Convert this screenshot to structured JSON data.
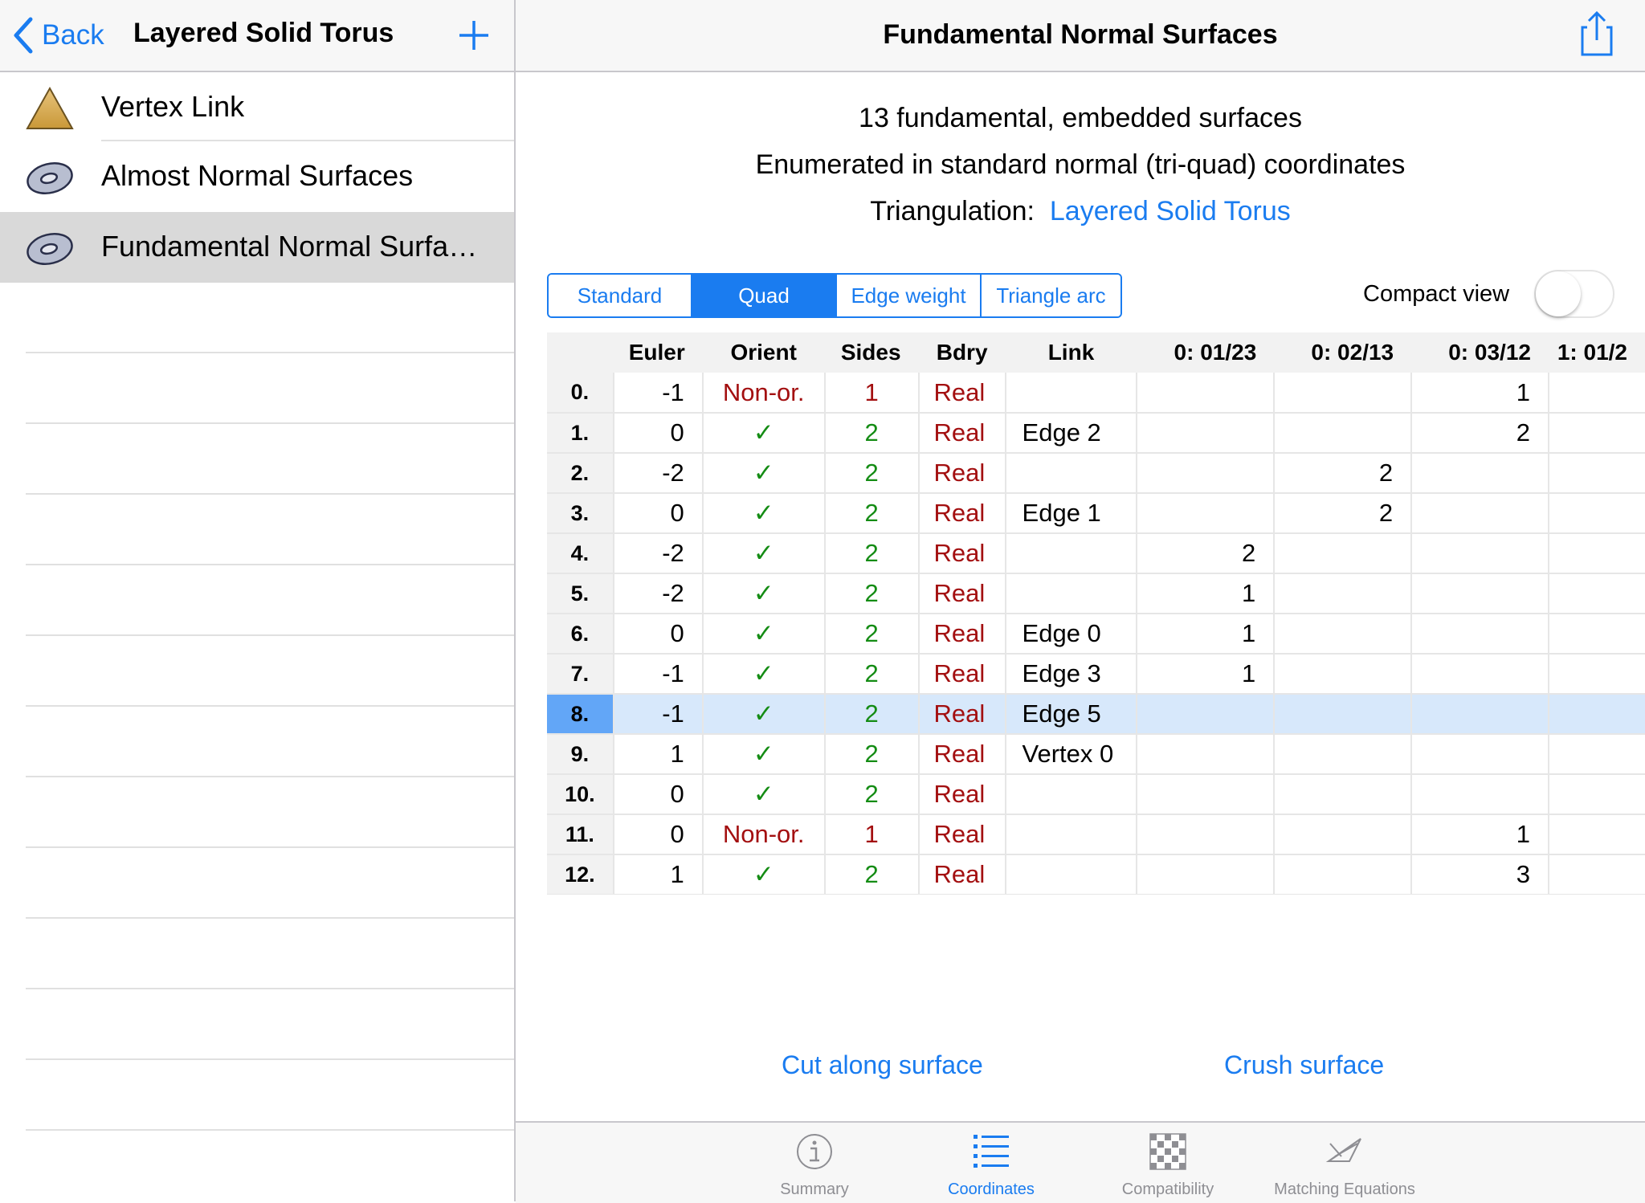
{
  "sidebar": {
    "back_label": "Back",
    "title": "Layered Solid Torus",
    "items": [
      {
        "label": "Vertex Link",
        "icon": "triangle-icon"
      },
      {
        "label": "Almost Normal Surfaces",
        "icon": "surface-icon"
      },
      {
        "label": "Fundamental Normal Surfa…",
        "icon": "surface-icon",
        "selected": true
      }
    ]
  },
  "main": {
    "title": "Fundamental Normal Surfaces",
    "summary_line1": "13 fundamental, embedded surfaces",
    "summary_line2": "Enumerated in standard normal (tri-quad) coordinates",
    "triangulation_label": "Triangulation:",
    "triangulation_link": "Layered Solid Torus",
    "segments": [
      "Standard",
      "Quad",
      "Edge weight",
      "Triangle arc"
    ],
    "active_segment": "Quad",
    "compact_view_label": "Compact view",
    "compact_view_on": false,
    "table": {
      "headers": [
        "",
        "Euler",
        "Orient",
        "Sides",
        "Bdry",
        "Link",
        "0: 01/23",
        "0: 02/13",
        "0: 03/12",
        "1: 01/2"
      ],
      "selected_row": 8,
      "rows": [
        [
          "0.",
          "-1",
          "Non-or.",
          "1",
          "Real",
          "",
          "",
          "",
          "1",
          ""
        ],
        [
          "1.",
          "0",
          "✓",
          "2",
          "Real",
          "Edge 2",
          "",
          "",
          "2",
          ""
        ],
        [
          "2.",
          "-2",
          "✓",
          "2",
          "Real",
          "",
          "",
          "2",
          "",
          ""
        ],
        [
          "3.",
          "0",
          "✓",
          "2",
          "Real",
          "Edge 1",
          "",
          "2",
          "",
          ""
        ],
        [
          "4.",
          "-2",
          "✓",
          "2",
          "Real",
          "",
          "2",
          "",
          "",
          ""
        ],
        [
          "5.",
          "-2",
          "✓",
          "2",
          "Real",
          "",
          "1",
          "",
          "",
          ""
        ],
        [
          "6.",
          "0",
          "✓",
          "2",
          "Real",
          "Edge 0",
          "1",
          "",
          "",
          ""
        ],
        [
          "7.",
          "-1",
          "✓",
          "2",
          "Real",
          "Edge 3",
          "1",
          "",
          "",
          ""
        ],
        [
          "8.",
          "-1",
          "✓",
          "2",
          "Real",
          "Edge 5",
          "",
          "",
          "",
          ""
        ],
        [
          "9.",
          "1",
          "✓",
          "2",
          "Real",
          "Vertex 0",
          "",
          "",
          "",
          ""
        ],
        [
          "10.",
          "0",
          "✓",
          "2",
          "Real",
          "",
          "",
          "",
          "",
          ""
        ],
        [
          "11.",
          "0",
          "Non-or.",
          "1",
          "Real",
          "",
          "",
          "",
          "1",
          ""
        ],
        [
          "12.",
          "1",
          "✓",
          "2",
          "Real",
          "",
          "",
          "",
          "3",
          ""
        ]
      ]
    },
    "actions": {
      "cut": "Cut along surface",
      "crush": "Crush surface"
    }
  },
  "tabbar": {
    "tabs": [
      {
        "label": "Summary",
        "icon": "info-icon"
      },
      {
        "label": "Coordinates",
        "icon": "list-icon",
        "active": true
      },
      {
        "label": "Compatibility",
        "icon": "grid-icon"
      },
      {
        "label": "Matching Equations",
        "icon": "equations-icon"
      }
    ]
  },
  "colors": {
    "accent": "#1a7cf0",
    "red": "#a30f10",
    "green": "#148c14",
    "selection": "#d7e8fb"
  }
}
